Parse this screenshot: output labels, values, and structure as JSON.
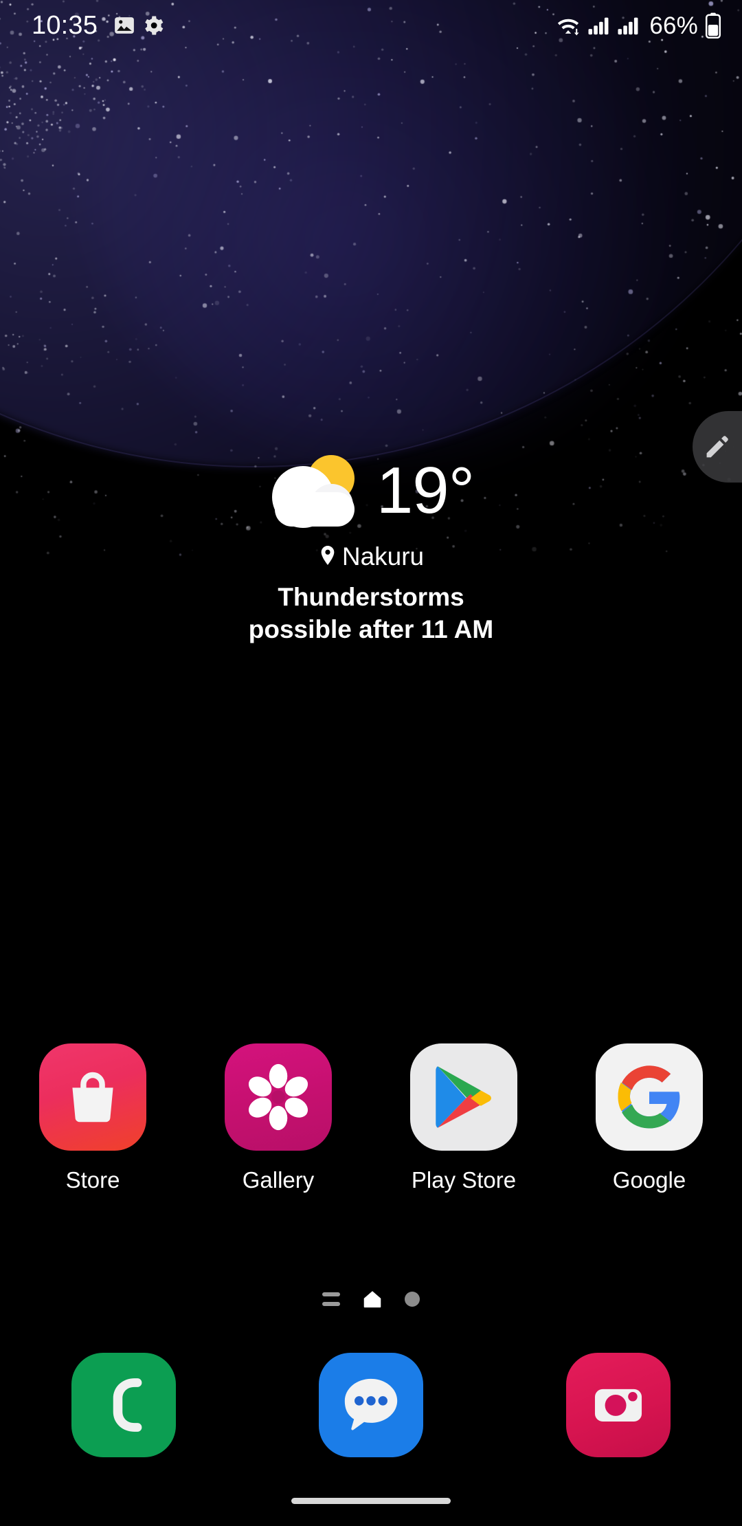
{
  "status_bar": {
    "clock": "10:35",
    "battery_percent": "66%",
    "icons": [
      {
        "name": "gallery-notification-icon",
        "glyph": "image"
      },
      {
        "name": "settings-notification-icon",
        "glyph": "gear"
      },
      {
        "name": "wifi-icon",
        "glyph": "wifi"
      },
      {
        "name": "signal-sim1-icon",
        "glyph": "signal"
      },
      {
        "name": "signal-sim2-icon",
        "glyph": "signal"
      },
      {
        "name": "battery-icon",
        "glyph": "battery"
      }
    ]
  },
  "edge_panel": {
    "handle_icon": "pencil-icon"
  },
  "weather": {
    "temperature": "19°",
    "condition_icon": "partly-cloudy-icon",
    "location_icon": "location-pin-icon",
    "city": "Nakuru",
    "condition_line1": "Thunderstorms",
    "condition_line2": "possible after 11 AM"
  },
  "app_grid": [
    {
      "label": "Store",
      "icon": "galaxy-store-icon"
    },
    {
      "label": "Gallery",
      "icon": "gallery-icon"
    },
    {
      "label": "Play Store",
      "icon": "play-store-icon"
    },
    {
      "label": "Google",
      "icon": "google-icon"
    }
  ],
  "page_indicator": {
    "items": [
      {
        "name": "app-list-indicator",
        "type": "bars",
        "active": false
      },
      {
        "name": "home-page-indicator",
        "type": "home",
        "active": true
      },
      {
        "name": "page-2-indicator",
        "type": "dot",
        "active": false
      }
    ]
  },
  "dock": [
    {
      "label": "Phone",
      "icon": "phone-icon"
    },
    {
      "label": "Messages",
      "icon": "messages-icon"
    },
    {
      "label": "Camera",
      "icon": "camera-icon"
    }
  ],
  "nav_bar": {
    "gesture_hint": "home-gesture-pill"
  },
  "colors": {
    "background": "#000000",
    "text_primary": "#ffffff",
    "store_pink": "#ec2e5d",
    "gallery_magenta": "#c5106f",
    "phone_green": "#0c9e52",
    "messages_blue": "#1b7de8",
    "camera_crimson": "#d71450",
    "sun_yellow": "#fbc52d",
    "wallpaper_indigo": "#3a3296"
  }
}
